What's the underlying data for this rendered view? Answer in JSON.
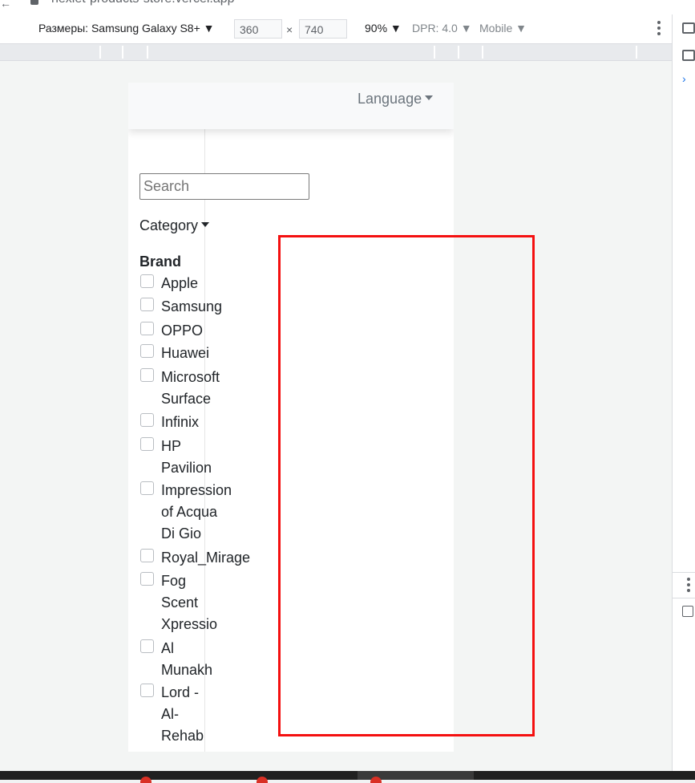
{
  "browser": {
    "url": "nexlet-products-store.vercel.app"
  },
  "device_toolbar": {
    "dimensions_label": "Размеры: Samsung Galaxy S8+",
    "width": "360",
    "separator": "×",
    "height": "740",
    "zoom": "90%",
    "dpr": "DPR: 4.0",
    "mode": "Mobile"
  },
  "page": {
    "navbar": {
      "language_label": "Language"
    },
    "search": {
      "placeholder": "Search"
    },
    "category_label": "Category",
    "brand": {
      "title": "Brand",
      "items": [
        {
          "label": "Apple"
        },
        {
          "label": "Samsung"
        },
        {
          "label": "OPPO"
        },
        {
          "label": "Huawei"
        },
        {
          "label": "Microsoft\nSurface"
        },
        {
          "label": "Infinix"
        },
        {
          "label": "HP\nPavilion"
        },
        {
          "label": "Impression\nof Acqua\nDi Gio"
        },
        {
          "label": "Royal_Mirage"
        },
        {
          "label": "Fog\nScent\nXpressio"
        },
        {
          "label": "Al\nMunakh"
        },
        {
          "label": "Lord -\nAl-\nRehab"
        }
      ]
    }
  },
  "colors": {
    "annotation": "#f41010",
    "navbar_bg": "#f8f9fa",
    "muted_text": "#6c757d"
  }
}
